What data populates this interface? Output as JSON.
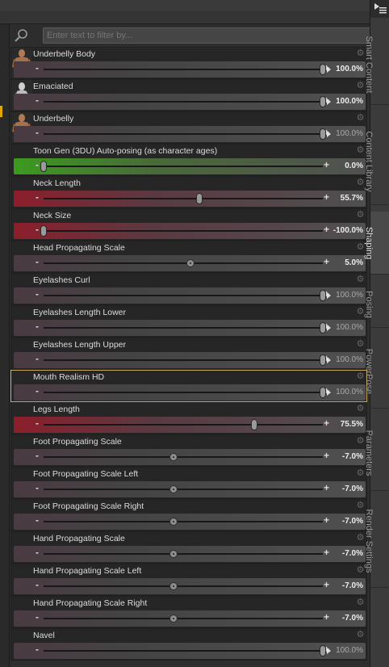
{
  "filter": {
    "placeholder": "Enter text to filter by..."
  },
  "colors": {
    "tint_neutral": "#3a3a3a",
    "tint_red": "#8c1e2b",
    "tint_green": "#3c9a1e",
    "selected_border": "#cda85a",
    "left_accent": "#e0a800"
  },
  "tabs": [
    {
      "label": "Smart Content",
      "active": false
    },
    {
      "label": "Content Library",
      "active": false
    },
    {
      "label": "Shaping",
      "active": true
    },
    {
      "label": "Posing",
      "active": false
    },
    {
      "label": "PowerPose",
      "active": false
    },
    {
      "label": "Parameters",
      "active": false
    },
    {
      "label": "Render Settings",
      "active": false
    }
  ],
  "rows": [
    {
      "label": "Underbelly Body",
      "value": "100.0%",
      "level": 1.0,
      "range": "pos",
      "thumb": "character-thumb",
      "tint": "neutral",
      "handle": "pill-arrow",
      "bold": true
    },
    {
      "label": "Emaciated",
      "value": "100.0%",
      "level": 1.0,
      "range": "pos",
      "thumb": "figure-thumb",
      "tint": "neutral",
      "handle": "pill-arrow",
      "bold": true
    },
    {
      "label": "Underbelly",
      "value": "100.0%",
      "level": 1.0,
      "range": "pos",
      "thumb": "character-thumb",
      "tint": "neutral",
      "handle": "pill-arrow",
      "bold": false
    },
    {
      "label": "Toon Gen (3DU) Auto-posing (as character ages)",
      "value": "0.0%",
      "level": 0.0,
      "range": "pos",
      "thumb": null,
      "tint": "green",
      "handle": "pill",
      "bold": true
    },
    {
      "label": "Neck Length",
      "value": "55.7%",
      "level": 0.557,
      "range": "pos",
      "thumb": null,
      "tint": "red",
      "handle": "pill",
      "bold": true
    },
    {
      "label": "Neck Size",
      "value": "-100.0%",
      "level": -1.0,
      "range": "pos",
      "thumb": null,
      "tint": "red",
      "handle": "pill",
      "bold": true
    },
    {
      "label": "Head Propagating Scale",
      "value": "5.0%",
      "level": 0.05,
      "range": "sym",
      "thumb": null,
      "tint": "neutral",
      "handle": "round",
      "bold": true
    },
    {
      "label": "Eyelashes Curl",
      "value": "100.0%",
      "level": 1.0,
      "range": "pos",
      "thumb": null,
      "tint": "neutral",
      "handle": "pill-arrow",
      "bold": false
    },
    {
      "label": "Eyelashes Length Lower",
      "value": "100.0%",
      "level": 1.0,
      "range": "pos",
      "thumb": null,
      "tint": "neutral",
      "handle": "pill-arrow",
      "bold": false
    },
    {
      "label": "Eyelashes Length Upper",
      "value": "100.0%",
      "level": 1.0,
      "range": "pos",
      "thumb": null,
      "tint": "neutral",
      "handle": "pill-arrow",
      "bold": false
    },
    {
      "label": "Mouth Realism HD",
      "value": "100.0%",
      "level": 1.0,
      "range": "pos",
      "thumb": null,
      "tint": "neutral",
      "handle": "pill-arrow",
      "bold": false,
      "selected": true
    },
    {
      "label": "Legs Length",
      "value": "75.5%",
      "level": 0.755,
      "range": "pos",
      "thumb": null,
      "tint": "red",
      "handle": "pill",
      "bold": true
    },
    {
      "label": "Foot Propagating Scale",
      "value": "-7.0%",
      "level": -0.07,
      "range": "sym",
      "thumb": null,
      "tint": "neutral",
      "handle": "round",
      "bold": true
    },
    {
      "label": "Foot Propagating Scale Left",
      "value": "-7.0%",
      "level": -0.07,
      "range": "sym",
      "thumb": null,
      "tint": "neutral",
      "handle": "round",
      "bold": true
    },
    {
      "label": "Foot Propagating Scale Right",
      "value": "-7.0%",
      "level": -0.07,
      "range": "sym",
      "thumb": null,
      "tint": "neutral",
      "handle": "round",
      "bold": true
    },
    {
      "label": "Hand Propagating Scale",
      "value": "-7.0%",
      "level": -0.07,
      "range": "sym",
      "thumb": null,
      "tint": "neutral",
      "handle": "round",
      "bold": true
    },
    {
      "label": "Hand Propagating Scale Left",
      "value": "-7.0%",
      "level": -0.07,
      "range": "sym",
      "thumb": null,
      "tint": "neutral",
      "handle": "round",
      "bold": true
    },
    {
      "label": "Hand Propagating Scale Right",
      "value": "-7.0%",
      "level": -0.07,
      "range": "sym",
      "thumb": null,
      "tint": "neutral",
      "handle": "round",
      "bold": true
    },
    {
      "label": "Navel",
      "value": "100.0%",
      "level": 1.0,
      "range": "pos",
      "thumb": null,
      "tint": "neutral",
      "handle": "pill-arrow",
      "bold": false
    }
  ]
}
